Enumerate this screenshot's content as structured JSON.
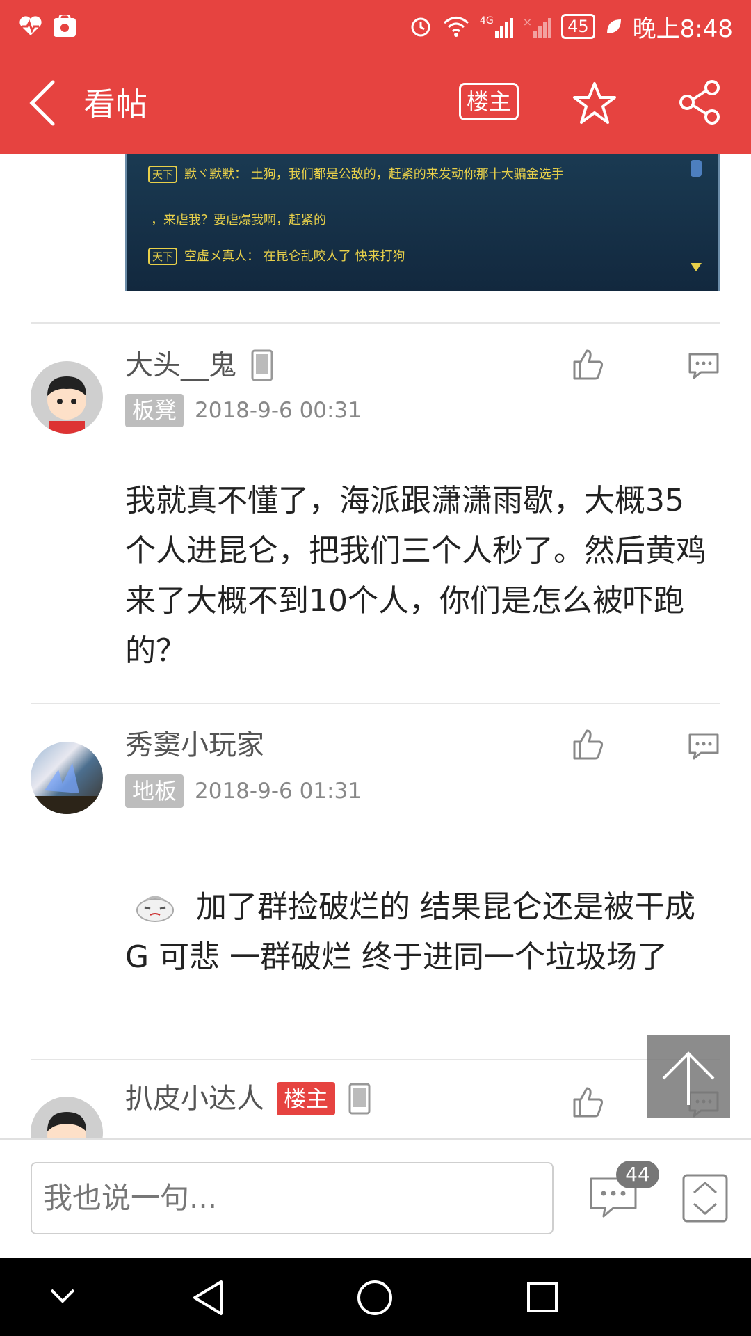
{
  "status_bar": {
    "network": "4G",
    "battery": "45",
    "time": "晚上8:48"
  },
  "header": {
    "title": "看帖",
    "op_button": "楼主"
  },
  "game_image": {
    "lines": [
      {
        "tag": "天下",
        "text": "默ヾ默默：   土狗，我们都是公敌的，赶紧的来发动你那十大骗金选手"
      },
      {
        "tag": "",
        "text": "，来虐我？要虐爆我啊，赶紧的"
      },
      {
        "tag": "天下",
        "text": "空虚メ真人：       在昆仑乱咬人了      快来打狗"
      }
    ]
  },
  "posts": [
    {
      "username": "大头__鬼",
      "floor": "板凳",
      "date": "2018-9-6 00:31",
      "text": "我就真不懂了，海派跟潇潇雨歇，大概35个人进昆仑，把我们三个人秒了。然后黄鸡来了大概不到10个人，你们是怎么被吓跑的？"
    },
    {
      "username": "秀窦小玩家",
      "floor": "地板",
      "date": "2018-9-6 01:31",
      "text": "加了群捡破烂的 结果昆仑还是被干成G 可悲 一群破烂 终于进同一个垃圾场了"
    },
    {
      "username": "扒皮小达人",
      "op_tag": "楼主"
    }
  ],
  "bottom_bar": {
    "placeholder": "我也说一句...",
    "comment_count": "44"
  }
}
